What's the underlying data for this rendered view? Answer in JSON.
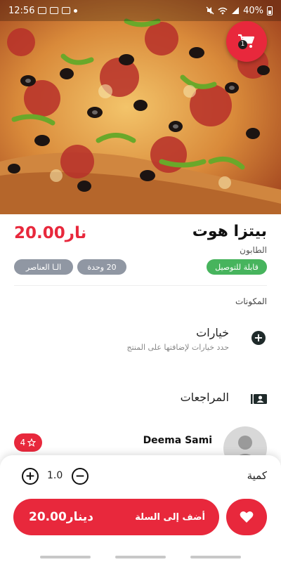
{
  "status_bar": {
    "time": "12:56",
    "battery": "40%"
  },
  "cart": {
    "count": "1"
  },
  "product": {
    "price": "20.00نار",
    "name": "بيتزا هوت",
    "category": "الطابون",
    "tags": [
      "قابلة للتوصيل",
      "20 وحدة",
      "الـا العناصر"
    ]
  },
  "sections": {
    "ingredients": "المكونات",
    "options_title": "خيارات",
    "options_desc": "حدد خيارات لإضافتها على المنتج",
    "reviews_title": "المراجعات"
  },
  "review": {
    "name": "Deema Sami",
    "rating": "4"
  },
  "bottom": {
    "quantity_label": "كمية",
    "quantity_value": "1.0",
    "add_label": "أضف إلى السلة",
    "add_price": "20.00دينار"
  },
  "colors": {
    "accent": "#e8283c",
    "green": "#47b45d",
    "gray_chip": "#9097a3"
  }
}
